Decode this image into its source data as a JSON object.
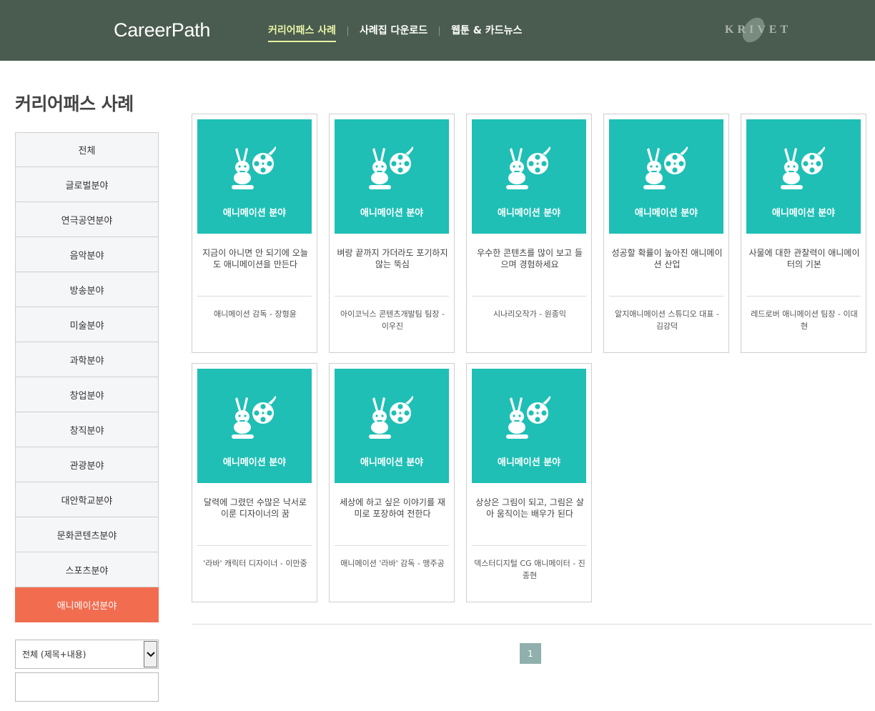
{
  "header": {
    "logo": "CareerPath",
    "nav": [
      {
        "label": "커리어패스 사례",
        "active": true
      },
      {
        "label": "사례집 다운로드",
        "active": false
      },
      {
        "label": "웹툰 & 카드뉴스",
        "active": false
      }
    ],
    "brand": "KRIVET"
  },
  "page_title": "커리어패스 사례",
  "sidebar": {
    "items": [
      {
        "label": "전체"
      },
      {
        "label": "글로벌분야"
      },
      {
        "label": "연극공연분야"
      },
      {
        "label": "음악분야"
      },
      {
        "label": "방송분야"
      },
      {
        "label": "미술분야"
      },
      {
        "label": "과학분야"
      },
      {
        "label": "창업분야"
      },
      {
        "label": "창직분야"
      },
      {
        "label": "관광분야"
      },
      {
        "label": "대안학교분야"
      },
      {
        "label": "문화콘텐츠분야"
      },
      {
        "label": "스포츠분야"
      },
      {
        "label": "애니메이션분야"
      }
    ],
    "active_index": 13
  },
  "search": {
    "select_value": "전체 (제목+내용)",
    "input_value": ""
  },
  "cards": [
    {
      "category": "애니메이션 분야",
      "title": "지금이 아니면 안 되기에 오늘도 애니메이션을 만든다",
      "author": "애니메이션 감독 - 장형윤"
    },
    {
      "category": "애니메이션 분야",
      "title": "벼랑 끝까지 가더라도 포기하지 않는 뚝심",
      "author": "아이코닉스 콘텐츠개발팀 팀장 - 이우진"
    },
    {
      "category": "애니메이션 분야",
      "title": "우수한 콘텐츠를 많이 보고 들으며 경험하세요",
      "author": "시나리오작가 - 원종익"
    },
    {
      "category": "애니메이션 분야",
      "title": "성공할 확률이 높아진 애니메이션 산업",
      "author": "알지애니메이션 스튜디오 대표 - 김강덕"
    },
    {
      "category": "애니메이션 분야",
      "title": "사물에 대한 관찰력이 애니메이터의 기본",
      "author": "레드로버 애니메이션 팀장 - 이대현"
    },
    {
      "category": "애니메이션 분야",
      "title": "달력에 그렸던 수많은 낙서로 이룬 디자이너의 꿈",
      "author": "'라바' 캐릭터 디자이너 - 이만중"
    },
    {
      "category": "애니메이션 분야",
      "title": "세상에 하고 싶은 이야기를 재미로 포장하여 전한다",
      "author": "애니메이션 '라바' 감독 - 맹주공"
    },
    {
      "category": "애니메이션 분야",
      "title": "상상은 그림이 되고, 그림은 살아 움직이는 배우가 된다",
      "author": "덱스터디지털 CG 애니메이터 - 진종현"
    }
  ],
  "pagination": {
    "current": "1"
  },
  "icons": {
    "card_thumb": "rabbit-film-reel-icon",
    "select_arrow": "chevron-down-icon"
  },
  "colors": {
    "header_bg": "#4a5c4f",
    "accent": "#f26d50",
    "thumb_bg": "#1fbfb5",
    "nav_active": "#e8f3a6"
  }
}
